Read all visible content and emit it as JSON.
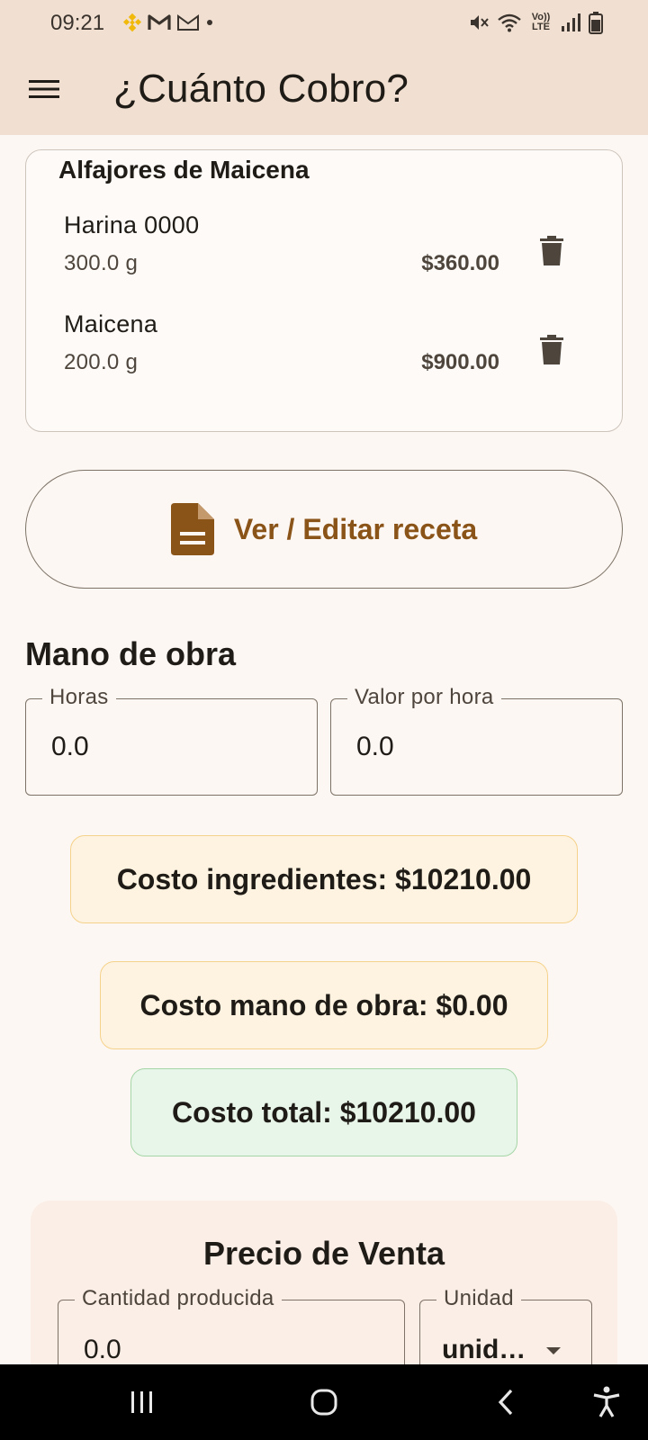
{
  "status_bar": {
    "time": "09:21",
    "left_icons": [
      "binance-icon",
      "gmail-icon",
      "gmail-outline-icon",
      "dot-icon"
    ],
    "right_icons": [
      "mute-icon",
      "wifi-icon",
      "volte-icon",
      "signal-icon",
      "battery-icon"
    ],
    "volte_label": "Vo)) LTE"
  },
  "app_bar": {
    "title": "¿Cuánto Cobro?"
  },
  "recipe": {
    "title": "Alfajores de Maicena",
    "ingredients": [
      {
        "name": "Harina 0000",
        "quantity": "300.0 g",
        "price": "$360.00"
      },
      {
        "name": "Maicena",
        "quantity": "200.0 g",
        "price": "$900.00"
      }
    ]
  },
  "recipe_button": {
    "label": "Ver / Editar receta"
  },
  "labor": {
    "title": "Mano de obra",
    "hours_label": "Horas",
    "hours_value": "0.0",
    "rate_label": "Valor por hora",
    "rate_value": "0.0"
  },
  "costs": {
    "ingredients": "Costo ingredientes: $10210.00",
    "labor": "Costo mano de obra: $0.00",
    "total": "Costo total: $10210.00"
  },
  "sale_price": {
    "title": "Precio de Venta",
    "quantity_label": "Cantidad producida",
    "quantity_value": "0.0",
    "unit_label": "Unidad",
    "unit_value": "unid…"
  },
  "colors": {
    "app_bar": "#f1e0d1",
    "background": "#fdf7f3",
    "accent": "#8a5317",
    "amber_chip": "#fef3e0",
    "green_chip": "#e8f5e9"
  }
}
